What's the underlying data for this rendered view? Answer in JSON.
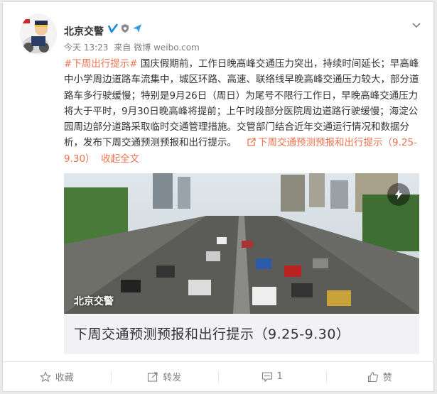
{
  "post": {
    "author": "北京交警",
    "time": "今天 13:23",
    "source_prefix": "来自",
    "source": "微博 weibo.com",
    "hashtag": "#下周出行提示#",
    "body": " 国庆假期前，工作日晚高峰交通压力突出，持续时间延长；早高峰中小学周边道路车流集中，城区环路、高速、联络线早晚高峰交通压力较大，部分道路车多行驶缓慢；特别是9月26日（周日）为尾号不限行工作日，早晚高峰交通压力将大于平时，9月30日晚高峰将提前；上午时段部分医院周边道路行驶缓慢；海淀公园周边部分道路采取临时交通管理措施。交管部门结合近年交通运行情况和数据分析，发布下周交通预测预报和出行提示。",
    "link_text": "下周交通预测预报和出行提示（9.25-9.30）",
    "collapse_text": "收起全文"
  },
  "article": {
    "watermark": "北京交警",
    "title": "下周交通预测预报和出行提示（9.25-9.30）"
  },
  "actions": {
    "favorite": "收藏",
    "repost": "转发",
    "comment_count": "1",
    "like": "赞"
  },
  "colors": {
    "accent": "#eb7350",
    "verified": "#1a8ad8"
  }
}
